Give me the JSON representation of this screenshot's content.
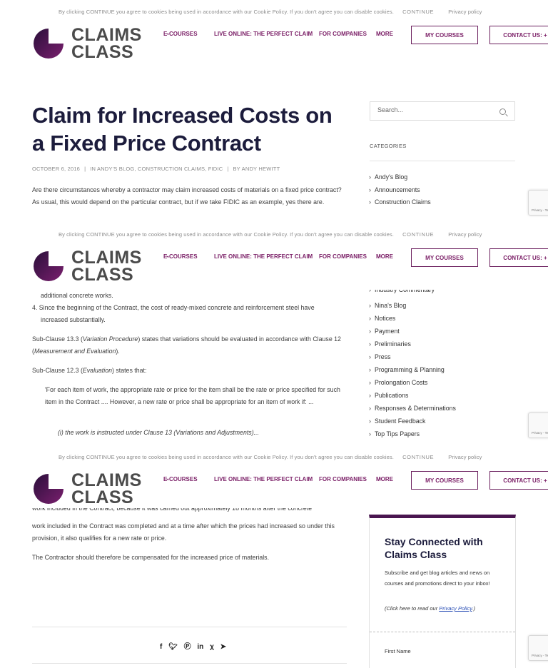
{
  "cookie_notice": {
    "text": "By clicking CONTINUE you agree to cookies being used in accordance with our Cookie Policy. If you don't agree you can disable cookies.",
    "continue_label": "CONTINUE",
    "privacy_label": "Privacy policy"
  },
  "header": {
    "logo_line1": "CLAIMS",
    "logo_line2": "CLASS",
    "nav": {
      "ecourses": "E-COURSES",
      "live_online": "LIVE ONLINE: THE PERFECT CLAIM",
      "for_companies": "FOR COMPANIES",
      "more": "MORE"
    },
    "my_courses": "MY COURSES",
    "contact_us": "CONTACT US: +"
  },
  "recaptcha_label": "Privacy - Terms",
  "article": {
    "title": "Claim for Increased Costs on a Fixed Price Contract",
    "meta_date": "OCTOBER 6, 2016",
    "meta_categories": "IN ANDY'S BLOG, CONSTRUCTION CLAIMS, FIDIC",
    "meta_author": "BY ANDY HEWITT",
    "intro": "Are there circumstances whereby a contractor may claim increased costs of materials on a fixed price contract? As usual, this would depend on the particular contract, but if we take FIDIC as an example, yes there are.",
    "p_additional": "additional concrete works.",
    "p_item4": "4. Since the beginning of the Contract, the cost of ready-mixed concrete and reinforcement steel have",
    "p_item4_cont": "increased substantially.",
    "p_sub133_a": "Sub-Clause 13.3 (",
    "p_sub133_em": "Variation Procedure",
    "p_sub133_b": ") states that variations should be evaluated in accordance with Clause 12 (",
    "p_sub133_em2": "Measurement and Evaluation",
    "p_sub133_c": ").",
    "p_sub123_a": "Sub-Clause 12.3 (",
    "p_sub123_em": "Evaluation",
    "p_sub123_b": ") states that:",
    "quote_a": "'For each item of work, the appropriate rate or price for the item shall be the rate or price specified for such item in the Contract .... However, a new rate or price shall be appropriate for an item of work if: ...",
    "quote_item": "(i) the work is instructed under Clause 13 (Variations and Adjustments)...",
    "p_partial_top": "work included in the Contract, because it was carried out approximately 18 months after the concrete",
    "p_continue": "work included in the Contract was completed and at a time after which the prices had increased so under this provision, it also qualifies for a new rate or price.",
    "p_conclusion": "The Contractor should therefore be compensated for the increased price of materials."
  },
  "sidebar": {
    "search_placeholder": "Search...",
    "categories_heading": "CATEGORIES",
    "categories_top": [
      "Andy's Blog",
      "Announcements",
      "Construction Claims"
    ],
    "categories_mid_partial": "Industry Commentary",
    "categories_mid": [
      "Nina's Blog",
      "Notices",
      "Payment",
      "Preliminaries",
      "Press",
      "Programming & Planning",
      "Prolongation Costs",
      "Publications",
      "Responses & Determinations",
      "Student Feedback",
      "Top Tips Papers"
    ]
  },
  "newsletter": {
    "title": "Stay Connected with Claims Class",
    "text": "Subscribe and get blog articles and news on courses and promotions direct to your inbox!",
    "privacy_prefix": "(Click here to read our ",
    "privacy_link": "Privacy Policy",
    "privacy_suffix": ".)",
    "first_name_label": "First Name"
  },
  "share_icons": [
    "facebook-icon",
    "twitter-icon",
    "pinterest-icon",
    "linkedin-icon",
    "xing-icon",
    "telegram-icon"
  ],
  "colors": {
    "brand_purple": "#7a1e66",
    "title_navy": "#1c1c3c",
    "newsletter_top": "#4a1550"
  }
}
